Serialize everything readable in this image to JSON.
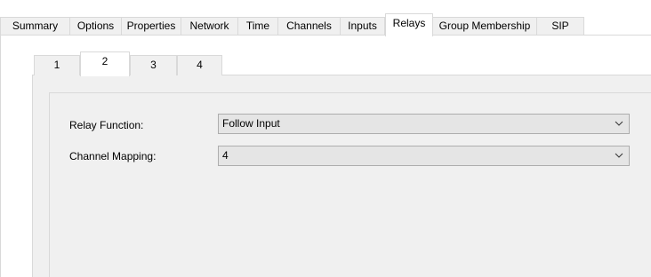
{
  "top_tabs": [
    {
      "label": "Summary"
    },
    {
      "label": "Options"
    },
    {
      "label": "Properties"
    },
    {
      "label": "Network"
    },
    {
      "label": "Time"
    },
    {
      "label": "Channels"
    },
    {
      "label": "Inputs"
    },
    {
      "label": "Relays",
      "active": true
    },
    {
      "label": "Group Membership"
    },
    {
      "label": "SIP"
    }
  ],
  "relay_tabs": [
    {
      "label": "1"
    },
    {
      "label": "2",
      "active": true
    },
    {
      "label": "3"
    },
    {
      "label": "4"
    }
  ],
  "form": {
    "relay_function_label": "Relay Function:",
    "relay_function_value": "Follow Input",
    "channel_mapping_label": "Channel Mapping:",
    "channel_mapping_value": "4"
  },
  "icons": {
    "dropdown": "chevron-down-icon"
  },
  "colors": {
    "panel_bg": "#f0f0f0",
    "combo_bg": "#e5e5e5",
    "border": "#d9d9d9"
  }
}
